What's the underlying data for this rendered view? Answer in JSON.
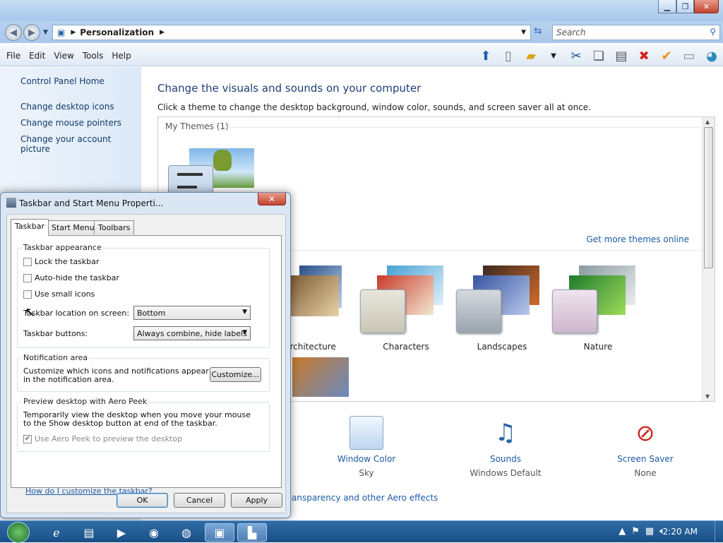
{
  "window": {
    "location": "Personalization",
    "search_placeholder": "Search"
  },
  "menu": [
    "File",
    "Edit",
    "View",
    "Tools",
    "Help"
  ],
  "left_pane": {
    "home": "Control Panel Home",
    "links": [
      "Change desktop icons",
      "Change mouse pointers",
      "Change your account picture"
    ]
  },
  "main": {
    "heading": "Change the visuals and sounds on your computer",
    "description": "Click a theme to change the desktop background, window color, sounds, and screen saver all at once.",
    "my_themes": "My Themes (1)",
    "get_more": "Get more themes online",
    "themes": [
      "Architecture",
      "Characters",
      "Landscapes",
      "Nature"
    ],
    "bottom": [
      {
        "label": "Window Color",
        "sub": "Sky"
      },
      {
        "label": "Sounds",
        "sub": "Windows Default"
      },
      {
        "label": "Screen Saver",
        "sub": "None"
      }
    ],
    "aero_link": "ansparency and other Aero effects"
  },
  "dialog": {
    "title": "Taskbar and Start Menu Properti...",
    "tabs": [
      "Taskbar",
      "Start Menu",
      "Toolbars"
    ],
    "appearance": {
      "title": "Taskbar appearance",
      "lock": "Lock the taskbar",
      "autohide": "Auto-hide the taskbar",
      "small_icons": "Use small icons",
      "location_label": "Taskbar location on screen:",
      "location_value": "Bottom",
      "buttons_label": "Taskbar buttons:",
      "buttons_value": "Always combine, hide labels"
    },
    "notification": {
      "title": "Notification area",
      "text": "Customize which icons and notifications appear in the notification area.",
      "button": "Customize..."
    },
    "peek": {
      "title": "Preview desktop with Aero Peek",
      "text": "Temporarily view the desktop when you move your mouse to the Show desktop button at end of the taskbar.",
      "checkbox": "Use Aero Peek to preview the desktop"
    },
    "help_link": "How do I customize the taskbar?",
    "ok": "OK",
    "cancel": "Cancel",
    "apply": "Apply"
  },
  "taskbar": {
    "clock": "2:20 AM"
  }
}
